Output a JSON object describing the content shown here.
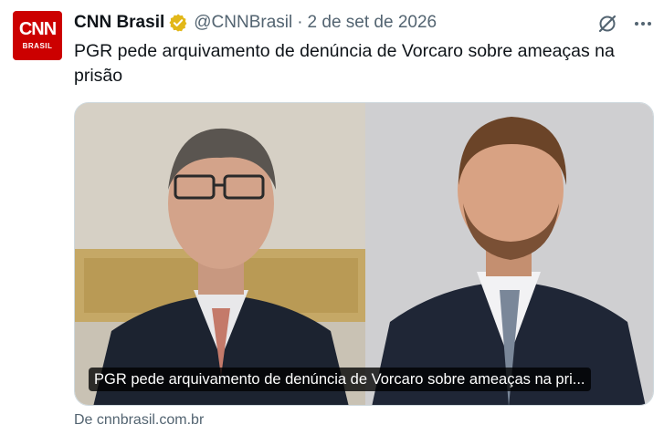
{
  "account": {
    "name": "CNN Brasil",
    "handle": "@CNNBrasil",
    "separator": "·",
    "date": "2 de set de 2026",
    "avatar_logo": "CNN",
    "avatar_sub": "BRASIL"
  },
  "tweet": {
    "text": "PGR pede arquivamento de denúncia de Vorcaro sobre ameaças na prisão"
  },
  "card": {
    "caption": "PGR pede arquivamento de denúncia de Vorcaro sobre ameaças na pri...",
    "source": "De cnnbrasil.com.br"
  },
  "icons": {
    "verified": "verified-badge-icon",
    "grok": "grok-icon",
    "more": "more-icon"
  },
  "colors": {
    "brand": "#cc0000",
    "verified_gold": "#e2b719",
    "secondary_text": "#536471"
  }
}
